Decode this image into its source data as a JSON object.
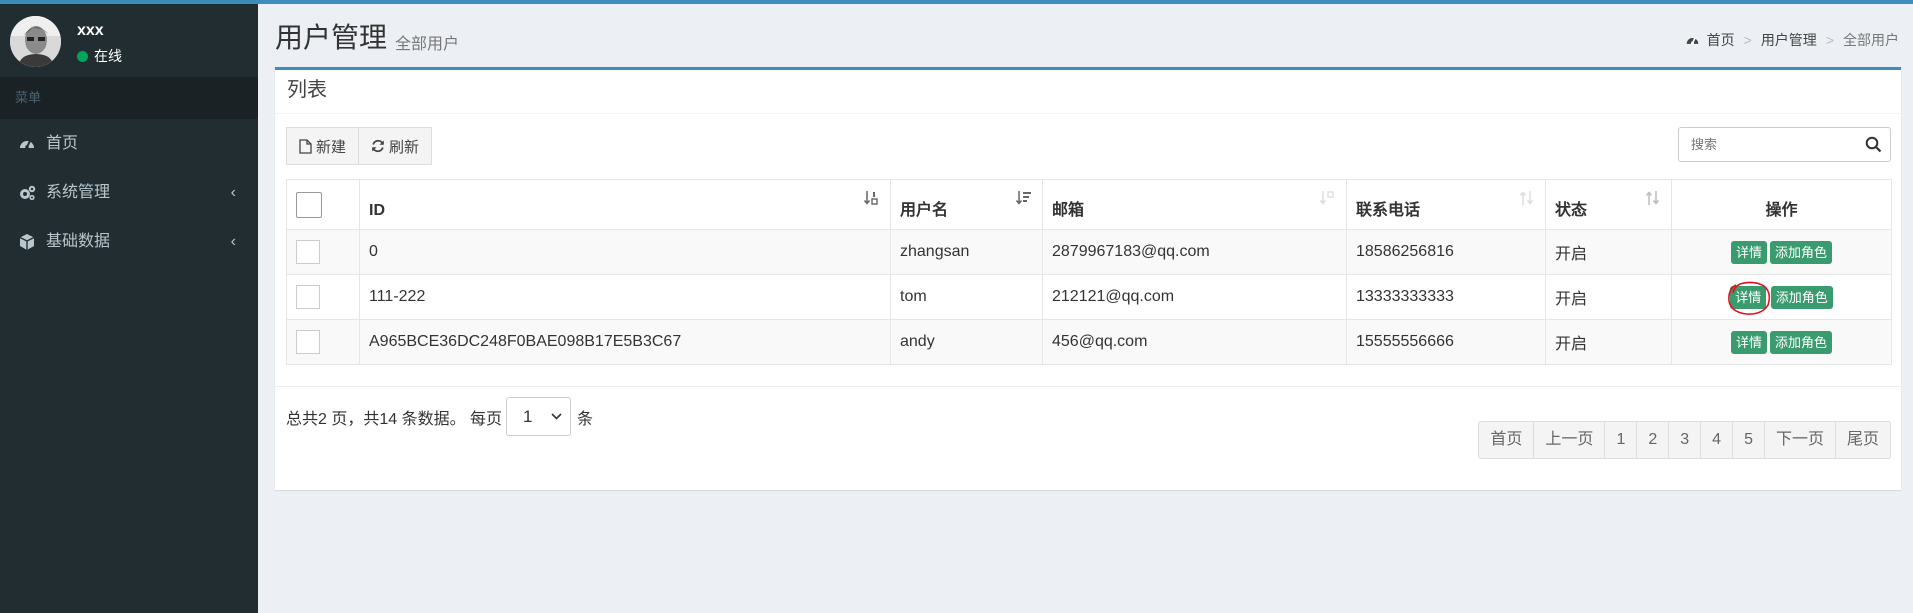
{
  "sidebar": {
    "username": "xxx",
    "status": "在线",
    "menu_header": "菜单",
    "items": [
      {
        "label": "首页",
        "icon": "dashboard-icon",
        "has_submenu": false
      },
      {
        "label": "系统管理",
        "icon": "gears-icon",
        "has_submenu": true
      },
      {
        "label": "基础数据",
        "icon": "cube-icon",
        "has_submenu": true
      }
    ],
    "chevron": "‹"
  },
  "header": {
    "title": "用户管理",
    "subtitle": "全部用户",
    "breadcrumb": [
      "首页",
      "用户管理",
      "全部用户"
    ],
    "breadcrumb_sep": ">"
  },
  "box": {
    "title": "列表",
    "buttons": {
      "new": "新建",
      "refresh": "刷新"
    },
    "search_placeholder": "搜索"
  },
  "table": {
    "columns": [
      "ID",
      "用户名",
      "邮箱",
      "联系电话",
      "状态",
      "操作"
    ],
    "rows": [
      {
        "id": "0",
        "username": "zhangsan",
        "email": "2879967183@qq.com",
        "phone": "18586256816",
        "status": "开启"
      },
      {
        "id": "111-222",
        "username": "tom",
        "email": "212121@qq.com",
        "phone": "13333333333",
        "status": "开启"
      },
      {
        "id": "A965BCE36DC248F0BAE098B17E5B3C67",
        "username": "andy",
        "email": "456@qq.com",
        "phone": "15555556666",
        "status": "开启"
      }
    ],
    "actions": {
      "detail": "详情",
      "add_role": "添加角色"
    }
  },
  "pagination": {
    "summary": "总共2 页，共14 条数据。 每页",
    "page_size": "1",
    "unit": "条",
    "buttons": [
      "首页",
      "上一页",
      "1",
      "2",
      "3",
      "4",
      "5",
      "下一页",
      "尾页"
    ]
  },
  "colors": {
    "accent": "#3c8dbc",
    "sidebar_bg": "#222d32",
    "action_green": "#3a9b6e",
    "online_green": "#00a65a",
    "annotation_red": "#e0131b"
  }
}
